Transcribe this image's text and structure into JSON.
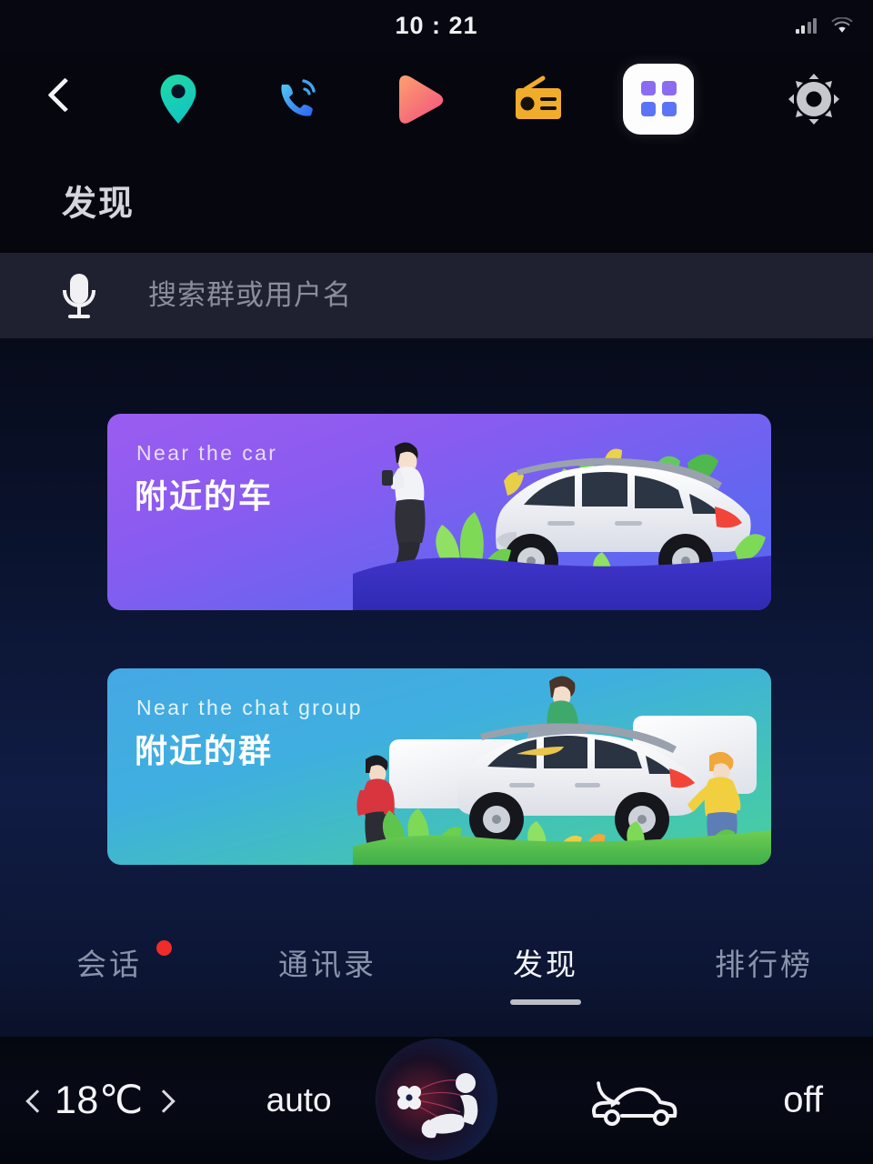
{
  "status": {
    "time": "10 : 21",
    "signal_icon": "signal-bars-icon",
    "wifi_icon": "wifi-icon"
  },
  "topnav": {
    "items": [
      {
        "name": "back-button",
        "icon": "chevron-left-icon"
      },
      {
        "name": "navigation-button",
        "icon": "map-pin-icon"
      },
      {
        "name": "phone-button",
        "icon": "phone-call-icon"
      },
      {
        "name": "media-button",
        "icon": "play-blob-icon"
      },
      {
        "name": "radio-button",
        "icon": "radio-icon"
      },
      {
        "name": "apps-button",
        "icon": "app-grid-icon"
      },
      {
        "name": "settings-button",
        "icon": "gear-icon"
      }
    ]
  },
  "header": {
    "title": "发现"
  },
  "search": {
    "placeholder": "搜索群或用户名",
    "value": "",
    "mic_icon": "microphone-icon"
  },
  "cards": [
    {
      "subtitle": "Near the car",
      "title": "附近的车",
      "gradient_from": "#9b5cf0",
      "gradient_to": "#5666ee",
      "art": "person-with-phone-beside-white-suv"
    },
    {
      "subtitle": "Near the chat group",
      "title": "附近的群",
      "gradient_from": "#45a8e4",
      "gradient_to": "#48cfa0",
      "art": "three-people-around-white-suv-with-chat-bubbles"
    }
  ],
  "tabs": [
    {
      "label": "会话",
      "active": false,
      "badge": true
    },
    {
      "label": "通讯录",
      "active": false,
      "badge": false
    },
    {
      "label": "发现",
      "active": true,
      "badge": false
    },
    {
      "label": "排行榜",
      "active": false,
      "badge": false
    }
  ],
  "climate": {
    "temp_decrease_icon": "chevron-left-icon",
    "temperature": "18℃",
    "temp_increase_icon": "chevron-right-icon",
    "auto_label": "auto",
    "airflow_dial_icon": "seat-airflow-dial-icon",
    "recirculation_icon": "air-recirculation-car-icon",
    "recirculation_state": "off"
  },
  "colors": {
    "badge_red": "#ef2b2b",
    "active_tab": "#f3f4f8",
    "inactive_tab": "#8b93ab",
    "search_bg": "#1f2130"
  }
}
